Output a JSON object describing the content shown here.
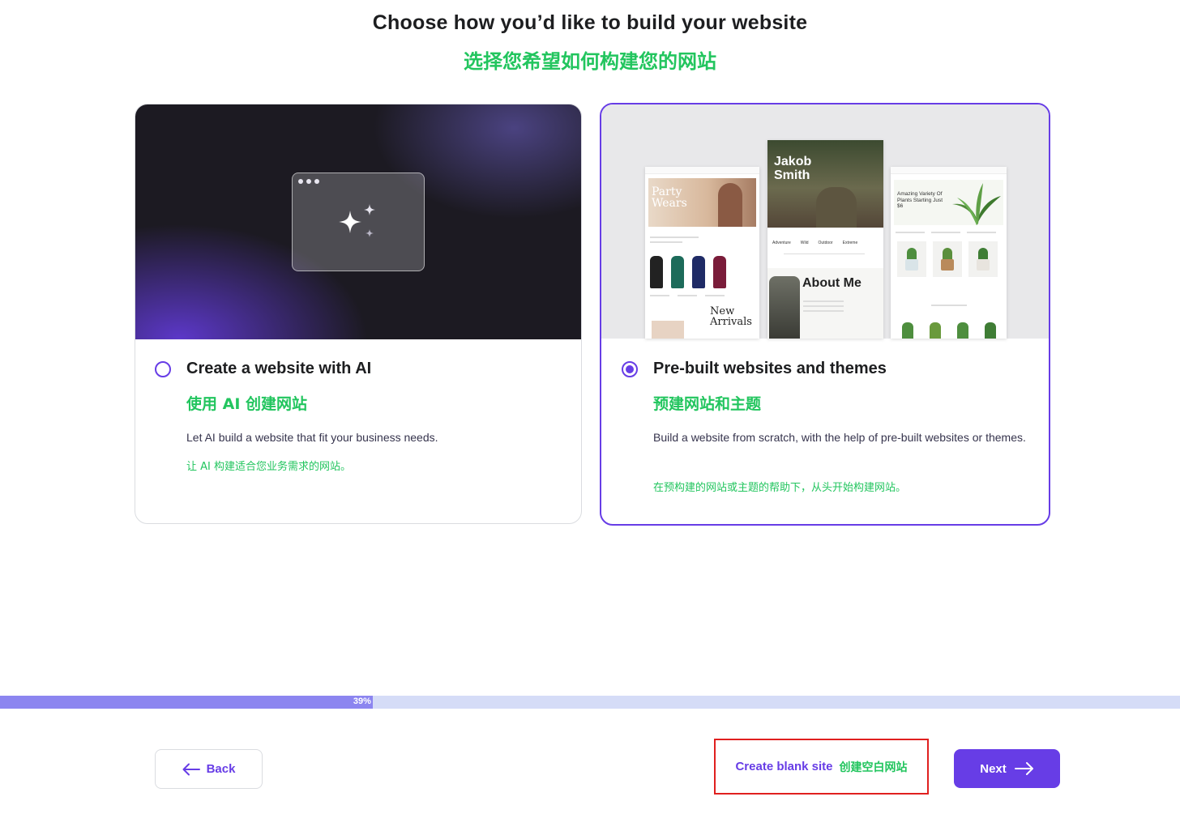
{
  "page": {
    "title": "Choose how you’d like to build your website",
    "subtitle": "选择您希望如何构建您的网站"
  },
  "options": [
    {
      "title": "Create a website with AI",
      "title_cn": "使用 AI 创建网站",
      "description": "Let AI build a website that fit your business needs.",
      "description_cn": "让 AI 构建适合您业务需求的网站。",
      "selected": false
    },
    {
      "title": "Pre-built websites and themes",
      "title_cn": "预建网站和主题",
      "description": "Build a website from scratch, with the help of pre-built websites or themes.",
      "description_cn": "在预构建的网站或主题的帮助下，从头开始构建网站。",
      "selected": true
    }
  ],
  "preview": {
    "fashion_heading": "Party Wears",
    "fashion_section": "New Arrivals",
    "portfolio_name": "Jakob Smith",
    "portfolio_links": [
      "Adventure",
      "Wild",
      "Outdoor",
      "Extreme"
    ],
    "portfolio_about": "About Me",
    "plants_heading": "Amazing Variety Of Plants Starting Just $6"
  },
  "progress": {
    "percent": 39,
    "label": "39%"
  },
  "footer": {
    "back_label": "Back",
    "blank_label": "Create blank site",
    "blank_label_cn": "创建空白网站",
    "next_label": "Next"
  },
  "colors": {
    "accent": "#673de6",
    "green_text": "#22c55e",
    "highlight_border": "#e0201f",
    "progress_fill": "#8c85f0",
    "progress_track": "#d5dcf7"
  }
}
